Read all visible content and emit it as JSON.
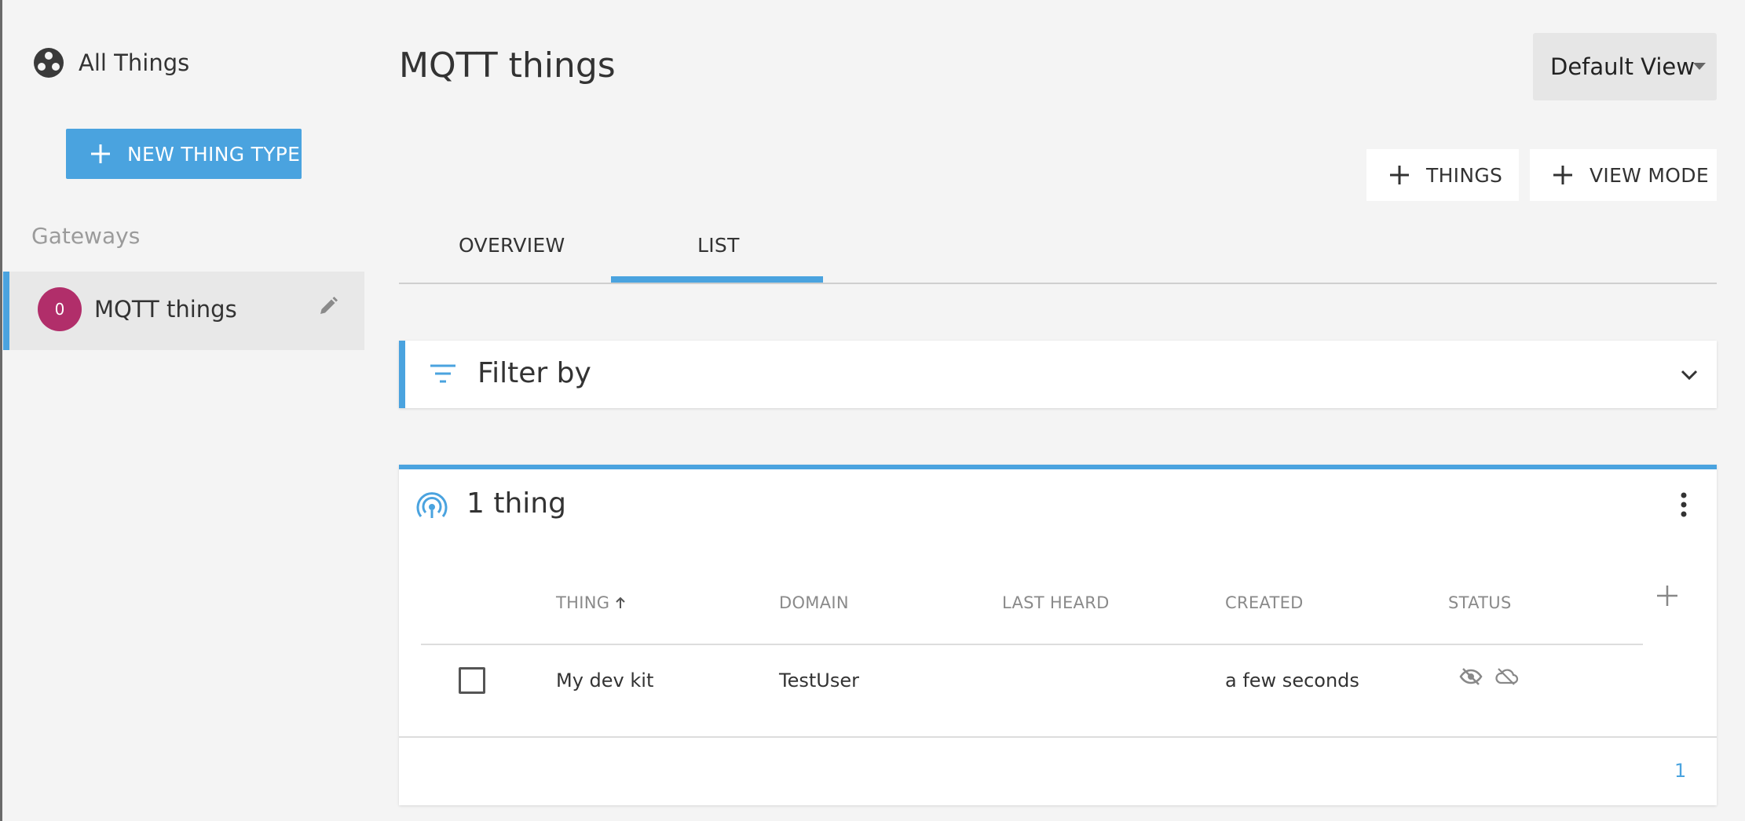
{
  "colors": {
    "accent": "#4aa3df",
    "avatar": "#b12e6a",
    "background": "#f4f4f4"
  },
  "sidebar": {
    "all_things_label": "All Things",
    "all_things_icon": "all-things-icon",
    "new_thing_type_label": "NEW THING TYPE",
    "gateways_heading": "Gateways",
    "gateway_items": [
      {
        "avatar_letter": "0",
        "label": "MQTT things",
        "selected": true
      }
    ]
  },
  "header": {
    "title": "MQTT things",
    "view_select": {
      "value": "Default View"
    },
    "buttons": {
      "things_label": "THINGS",
      "view_mode_label": "VIEW MODE"
    }
  },
  "tabs": [
    {
      "label": "OVERVIEW",
      "active": false
    },
    {
      "label": "LIST",
      "active": true
    }
  ],
  "filter": {
    "label": "Filter by"
  },
  "things": {
    "title": "1 thing",
    "columns": [
      "THING",
      "DOMAIN",
      "LAST HEARD",
      "CREATED",
      "STATUS"
    ],
    "sort_column": "THING",
    "rows": [
      {
        "thing": "My dev kit",
        "domain": "TestUser",
        "last_heard": "",
        "created": "a few seconds",
        "status_icons": [
          "hidden-eye-icon",
          "cloud-off-icon"
        ]
      }
    ],
    "pagination": {
      "current_page": "1"
    }
  }
}
